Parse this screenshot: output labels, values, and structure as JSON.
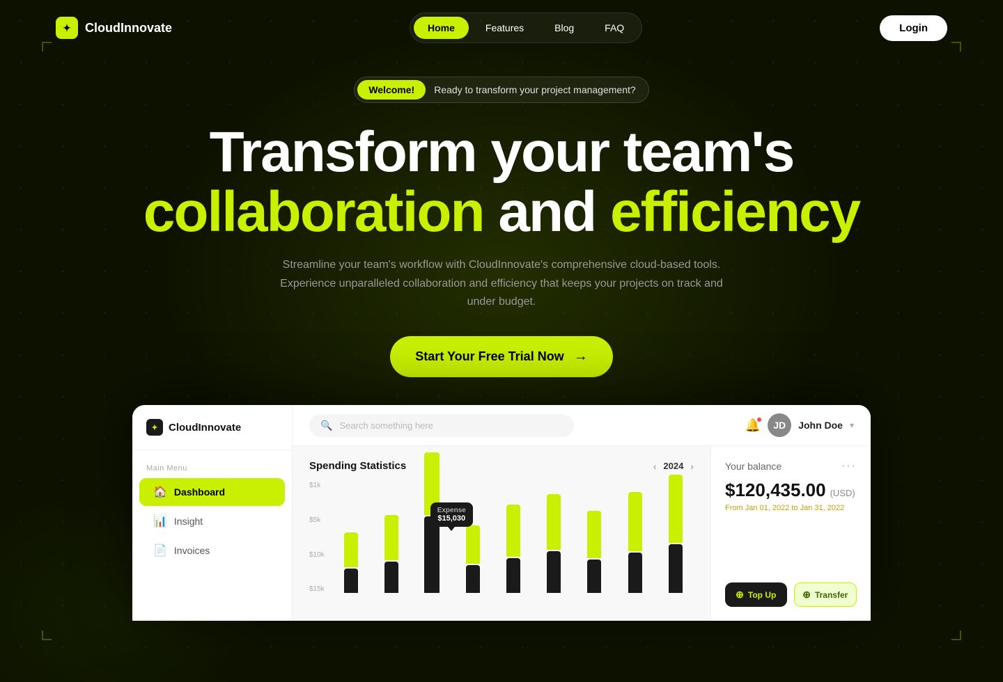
{
  "brand": {
    "name": "CloudInnovate",
    "logo_icon": "✦"
  },
  "nav": {
    "links": [
      {
        "label": "Home",
        "active": true
      },
      {
        "label": "Features",
        "active": false
      },
      {
        "label": "Blog",
        "active": false
      },
      {
        "label": "FAQ",
        "active": false
      }
    ],
    "login_label": "Login"
  },
  "hero": {
    "badge_tag": "Welcome!",
    "badge_text": "Ready to transform your project management?",
    "title_line1": "Transform your team's",
    "title_lime1": "collaboration",
    "title_mid": " and ",
    "title_lime2": "efficiency",
    "subtitle": "Streamline your team's workflow with CloudInnovate's comprehensive cloud-based tools. Experience unparalleled collaboration and efficiency that keeps your projects on track and under budget.",
    "cta_label": "Start Your Free Trial Now",
    "cta_arrow": "→"
  },
  "dashboard": {
    "logo": "CloudInnovate",
    "logo_icon": "✦",
    "menu_label": "Main Menu",
    "menu_items": [
      {
        "label": "Dashboard",
        "icon": "🏠",
        "active": true
      },
      {
        "label": "Insight",
        "icon": "📊",
        "active": false
      },
      {
        "label": "Invoices",
        "icon": "📄",
        "active": false
      }
    ],
    "search_placeholder": "Search something here",
    "user_name": "John Doe",
    "chart_title": "Spending Statistics",
    "chart_year": "2024",
    "chart_tooltip_label": "Expense",
    "chart_tooltip_value": "$15,030",
    "chart_y_labels": [
      "$15k",
      "$10k",
      "$5k",
      "$1k"
    ],
    "chart_bars": [
      {
        "lime_h": 60,
        "dark_h": 40
      },
      {
        "lime_h": 80,
        "dark_h": 55
      },
      {
        "lime_h": 110,
        "dark_h": 130
      },
      {
        "lime_h": 70,
        "dark_h": 50
      },
      {
        "lime_h": 90,
        "dark_h": 60
      },
      {
        "lime_h": 95,
        "dark_h": 70
      },
      {
        "lime_h": 80,
        "dark_h": 55
      },
      {
        "lime_h": 100,
        "dark_h": 65
      },
      {
        "lime_h": 115,
        "dark_h": 80
      }
    ],
    "balance_title": "Your balance",
    "balance_amount": "$120,435.00",
    "balance_currency": "(USD)",
    "balance_date": "From Jan 01, 2022 to Jan 31, 2022",
    "topup_label": "Top Up",
    "transfer_label": "Transfer",
    "topup_icon": "↑",
    "transfer_icon": "↗"
  }
}
